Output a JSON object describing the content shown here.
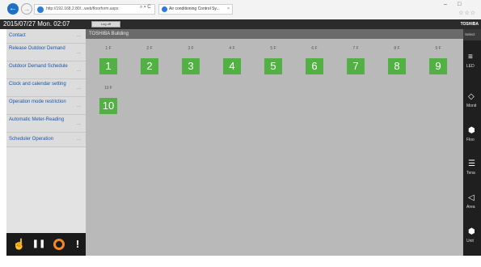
{
  "browser": {
    "url": "http://192.168.2.80/...web/floorform.aspx",
    "address_tools": "⌕ ▾ C",
    "tab_title": "Air conditioning Control Sy...",
    "close_symbol": "×",
    "minimize": "–",
    "maximize": "□",
    "stars": "☆☆☆"
  },
  "header": {
    "datetime": "2015/07/27  Mon.  02:07",
    "logoff_label": "Log off",
    "brand": "TOSHIBA"
  },
  "sidebar": {
    "items": [
      {
        "label": "Contact",
        "more": "..."
      },
      {
        "label": "Release Outdoor Demand",
        "more": "..."
      },
      {
        "label": "Outdoor Demand Schedule",
        "more": "..."
      },
      {
        "label": "Clock and calendar setting",
        "more": "..."
      },
      {
        "label": "Operation mode restriction",
        "more": "..."
      },
      {
        "label": "Automatic Meter-Reading",
        "more": "..."
      },
      {
        "label": "Scheduler Operation",
        "more": "..."
      }
    ]
  },
  "bottom_bar": {
    "hand": "☝",
    "pause": "❚❚",
    "alert": "!"
  },
  "main": {
    "building_title": "TOSHIBA Building",
    "floors": [
      {
        "label": "1 F",
        "number": "1"
      },
      {
        "label": "2 F",
        "number": "2"
      },
      {
        "label": "3 F",
        "number": "3"
      },
      {
        "label": "4 F",
        "number": "4"
      },
      {
        "label": "5 F",
        "number": "5"
      },
      {
        "label": "6 F",
        "number": "6"
      },
      {
        "label": "7 F",
        "number": "7"
      },
      {
        "label": "8 F",
        "number": "8"
      },
      {
        "label": "9 F",
        "number": "9"
      },
      {
        "label": "10 F",
        "number": "10"
      }
    ]
  },
  "rail": {
    "select_label": "Select",
    "items": [
      {
        "label": "LED",
        "icon": "≡"
      },
      {
        "label": "Monit",
        "icon": "◇"
      },
      {
        "label": "Floo",
        "icon": "⬢"
      },
      {
        "label": "Tena",
        "icon": "☰"
      },
      {
        "label": "Area",
        "icon": "◁"
      },
      {
        "label": "Unit",
        "icon": "⬢"
      }
    ]
  },
  "colors": {
    "floor_green": "#52b044",
    "accent_blue": "#1b55a5",
    "orange_ring": "#f08a24"
  }
}
